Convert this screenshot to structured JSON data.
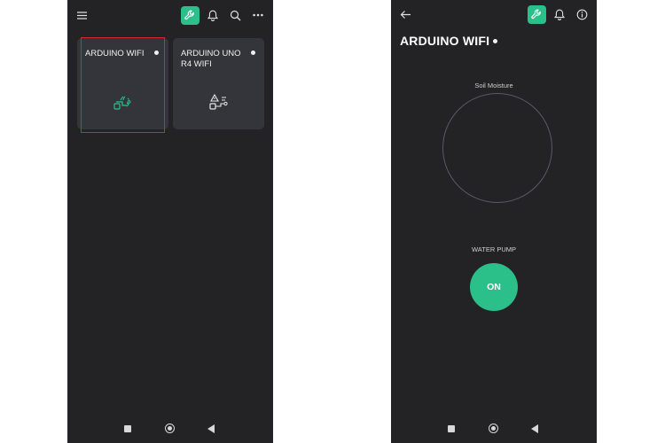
{
  "left_screen": {
    "devices": [
      {
        "name": "ARDUINO WIFI",
        "status": "online"
      },
      {
        "name": "ARDUINO UNO R4 WIFI",
        "status": "online"
      }
    ],
    "icons": [
      "menu-icon",
      "wrench-icon",
      "bell-icon",
      "search-icon",
      "more-icon"
    ]
  },
  "right_screen": {
    "title": "ARDUINO WIFI",
    "gauge_label": "Soil Moisture",
    "pump_label": "WATER PUMP",
    "pump_button_label": "ON",
    "icons": [
      "back-arrow-icon",
      "wrench-icon",
      "bell-icon",
      "info-icon"
    ]
  },
  "colors": {
    "background": "#232326",
    "card": "#34353a",
    "accent": "#2bc08a",
    "highlight": "#d9232e"
  }
}
